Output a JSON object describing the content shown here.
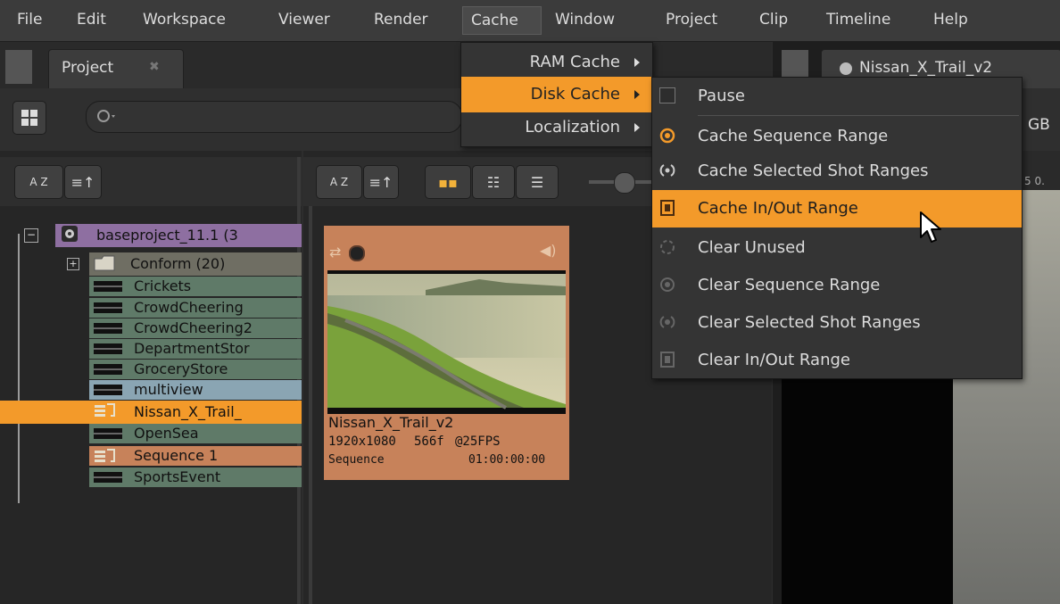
{
  "menubar": {
    "items": [
      "File",
      "Edit",
      "Workspace",
      "Viewer",
      "Render",
      "Cache",
      "Window",
      "Project",
      "Clip",
      "Timeline",
      "Help"
    ]
  },
  "project_panel": {
    "tab_label": "Project",
    "tab_close": "✖"
  },
  "bin_tree": {
    "sort_label": "A Z",
    "items": [
      {
        "label": "baseproject_11.1 (3",
        "icon": "project-icon",
        "color": "#8e6fa1"
      },
      {
        "label": "Conform (20)",
        "icon": "folder-icon",
        "color": "#6f6e63"
      },
      {
        "label": "Crickets",
        "icon": "clip-icon",
        "color": "#5f7a68"
      },
      {
        "label": "CrowdCheering",
        "icon": "clip-icon",
        "color": "#5f7a68"
      },
      {
        "label": "CrowdCheering2",
        "icon": "clip-icon",
        "color": "#5f7a68"
      },
      {
        "label": "DepartmentStor",
        "icon": "clip-icon",
        "color": "#5f7a68"
      },
      {
        "label": "GroceryStore",
        "icon": "clip-icon",
        "color": "#5f7a68"
      },
      {
        "label": "multiview",
        "icon": "clip-icon",
        "color": "#8aa5b3"
      },
      {
        "label": "Nissan_X_Trail_",
        "icon": "sequence-icon",
        "color": "#f39a2a"
      },
      {
        "label": "OpenSea",
        "icon": "clip-icon",
        "color": "#5f7a68"
      },
      {
        "label": "Sequence 1",
        "icon": "sequence-icon",
        "color": "#c7825a"
      },
      {
        "label": "SportsEvent",
        "icon": "clip-icon",
        "color": "#5f7a68"
      }
    ]
  },
  "clip_card": {
    "name": "Nissan_X_Trail_v2",
    "resolution": "1920x1080",
    "frames": "566f",
    "fps": "@25FPS",
    "type": "Sequence",
    "timecode": "01:00:00:00"
  },
  "viewer": {
    "tab_label": "Nissan_X_Trail_v2",
    "channel": "GB",
    "frame_hint": "5 0."
  },
  "cache_menu": {
    "items": [
      {
        "label": "RAM Cache"
      },
      {
        "label": "Disk Cache"
      },
      {
        "label": "Localization"
      }
    ]
  },
  "disk_cache_submenu": {
    "items": [
      {
        "label": "Pause",
        "icon": "checkbox-icon"
      },
      {
        "label": "Cache Sequence Range",
        "icon": "radio-active-icon"
      },
      {
        "label": "Cache Selected Shot Ranges",
        "icon": "radio-icon"
      },
      {
        "label": "Cache In/Out Range",
        "icon": "film-range-icon"
      },
      {
        "label": "Clear Unused",
        "icon": "clear-unused-icon"
      },
      {
        "label": "Clear Sequence Range",
        "icon": "clear-sequence-icon"
      },
      {
        "label": "Clear Selected Shot Ranges",
        "icon": "clear-shots-icon"
      },
      {
        "label": "Clear In/Out Range",
        "icon": "clear-inout-icon"
      }
    ]
  },
  "colors": {
    "accent": "#f39a2a",
    "panel": "#262626",
    "menu": "#343434"
  }
}
